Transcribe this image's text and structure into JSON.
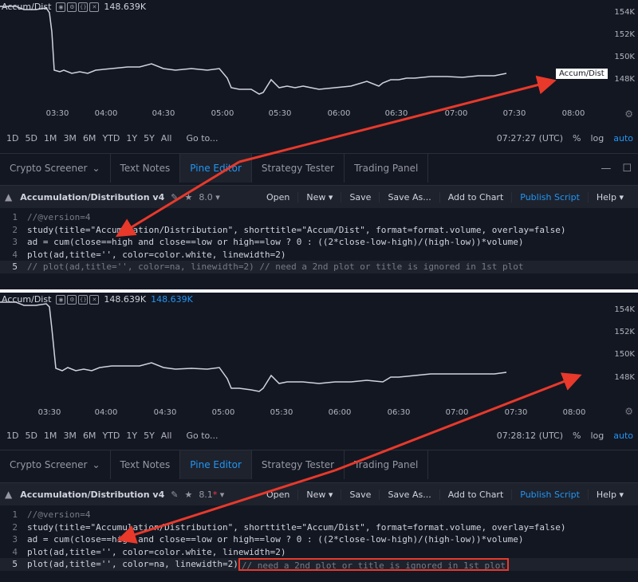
{
  "top": {
    "legend": {
      "name": "Accum/Dist",
      "value": "148.639K",
      "value2": ""
    },
    "price_ticks": [
      "154K",
      "152K",
      "150K",
      "148K"
    ],
    "price_tag": "Accum/Dist",
    "time_ticks": [
      "03:30",
      "04:00",
      "04:30",
      "05:00",
      "05:30",
      "06:00",
      "06:30",
      "07:00",
      "07:30",
      "08:00"
    ],
    "ranges": [
      "1D",
      "5D",
      "1M",
      "3M",
      "6M",
      "YTD",
      "1Y",
      "5Y",
      "All"
    ],
    "goto": "Go to...",
    "clock": "07:27:27 (UTC)",
    "pct": "%",
    "log": "log",
    "auto": "auto",
    "tabs": [
      "Crypto Screener",
      "Text Notes",
      "Pine Editor",
      "Strategy Tester",
      "Trading Panel"
    ],
    "script_title": "Accumulation/Distribution v4",
    "version": "8.0",
    "actions": [
      "Open",
      "New",
      "Save",
      "Save As...",
      "Add to Chart",
      "Publish Script",
      "Help"
    ],
    "code": [
      "//@version=4",
      "study(title=\"Accumulation/Distribution\", shorttitle=\"Accum/Dist\", format=format.volume, overlay=false)",
      "ad = cum(close==high and close==low or high==low ? 0 : ((2*close-low-high)/(high-low))*volume)",
      "plot(ad,title='', color=color.white, linewidth=2)",
      "// plot(ad,title='', color=na, linewidth=2) // need a 2nd plot or title is ignored in 1st plot"
    ],
    "line_numbers": [
      "1",
      "2",
      "3",
      "4",
      "5"
    ]
  },
  "bottom": {
    "legend": {
      "name": "Accum/Dist",
      "value": "148.639K",
      "value2": "148.639K"
    },
    "price_ticks": [
      "154K",
      "152K",
      "150K",
      "148K"
    ],
    "time_ticks": [
      "03:30",
      "04:00",
      "04:30",
      "05:00",
      "05:30",
      "06:00",
      "06:30",
      "07:00",
      "07:30",
      "08:00"
    ],
    "ranges": [
      "1D",
      "5D",
      "1M",
      "3M",
      "6M",
      "YTD",
      "1Y",
      "5Y",
      "All"
    ],
    "goto": "Go to...",
    "clock": "07:28:12 (UTC)",
    "pct": "%",
    "log": "log",
    "auto": "auto",
    "tabs": [
      "Crypto Screener",
      "Text Notes",
      "Pine Editor",
      "Strategy Tester",
      "Trading Panel"
    ],
    "script_title": "Accumulation/Distribution v4",
    "version": "8.1",
    "actions": [
      "Open",
      "New",
      "Save",
      "Save As...",
      "Add to Chart",
      "Publish Script",
      "Help"
    ],
    "code": [
      "//@version=4",
      "study(title=\"Accumulation/Distribution\", shorttitle=\"Accum/Dist\", format=format.volume, overlay=false)",
      "ad = cum(close==high and close==low or high==low ? 0 : ((2*close-low-high)/(high-low))*volume)",
      "plot(ad,title='', color=color.white, linewidth=2)",
      "plot(ad,title='', color=na, linewidth=2)",
      "// need a 2nd plot or title is ignored in 1st plot"
    ],
    "line_numbers": [
      "1",
      "2",
      "3",
      "4",
      "5"
    ]
  },
  "colors": {
    "bg": "#131722",
    "accent": "#2196f3",
    "annotation": "#e8392b",
    "line": "#d1d4dc"
  }
}
